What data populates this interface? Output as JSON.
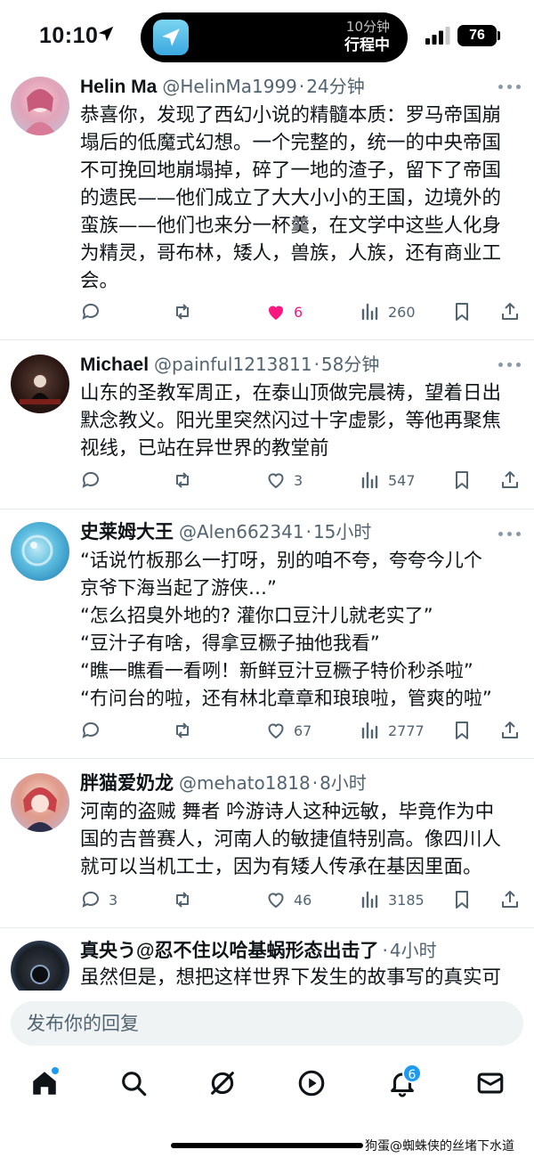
{
  "status_bar": {
    "time": "10:10",
    "island_line1": "10分钟",
    "island_line2": "行程中",
    "battery": "76"
  },
  "tweets": [
    {
      "name": "Helin Ma",
      "handle": "@HelinMa1999",
      "sep": "·",
      "time": "24分钟",
      "lines": [
        "恭喜你，发现了西幻小说的精髓本质：罗马帝国崩",
        "塌后的低魔式幻想。一个完整的，统一的中央帝国",
        "不可挽回地崩塌掉，碎了一地的渣子，留下了帝国",
        "的遗民——他们成立了大大小小的王国，边境外的",
        "蛮族——他们也来分一杯羹，在文学中这些人化身",
        "为精灵，哥布林，矮人，兽族，人族，还有商业工",
        "会。"
      ],
      "replies": "",
      "retweets": "",
      "likes": "6",
      "views": "260"
    },
    {
      "name": "Michael",
      "handle": "@painful1213811",
      "sep": "·",
      "time": "58分钟",
      "lines": [
        "山东的圣教军周正，在泰山顶做完晨祷，望着日出",
        "默念教义。阳光里突然闪过十字虚影，等他再聚焦",
        "视线，已站在异世界的教堂前"
      ],
      "replies": "",
      "retweets": "",
      "likes": "3",
      "views": "547"
    },
    {
      "name": "史莱姆大王",
      "handle": "@Alen662341",
      "sep": "·",
      "time": "15小时",
      "lines": [
        "“话说竹板那么一打呀，别的咱不夸，夸夸今儿个",
        "京爷下海当起了游侠…”",
        "“怎么招臭外地的? 灌你口豆汁儿就老实了”",
        "“豆汁子有啥，得拿豆橛子抽他我看”",
        "“瞧一瞧看一看咧！新鲜豆汁豆橛子特价秒杀啦”",
        "“冇问台的啦，还有林北章章和琅琅啦，管爽的啦”"
      ],
      "replies": "",
      "retweets": "",
      "likes": "67",
      "views": "2777"
    },
    {
      "name": "胖猫爱奶龙",
      "handle": "@mehato1818",
      "sep": "·",
      "time": "8小时",
      "lines": [
        "河南的盗贼 舞者 吟游诗人这种远敏，毕竟作为中",
        "国的吉普赛人，河南人的敏捷值特别高。像四川人",
        "就可以当机工士，因为有矮人传承在基因里面。"
      ],
      "replies": "3",
      "retweets": "",
      "likes": "46",
      "views": "3185"
    },
    {
      "name": "真央う@忍不住以哈基蜗形态出击了",
      "handle": "",
      "sep": "·",
      "time": "4小时",
      "lines": [
        "虽然但是，想把这样世界下发生的故事写的真实可"
      ]
    }
  ],
  "reply_bar": {
    "placeholder": "发布你的回复"
  },
  "nav": {
    "notifications_badge": "6"
  },
  "watermark": "狗蛋@蜘蛛侠的丝堵下水道",
  "colors": {
    "accent": "#1d9bf0",
    "like": "#f91880",
    "secondary_text": "#536471"
  }
}
